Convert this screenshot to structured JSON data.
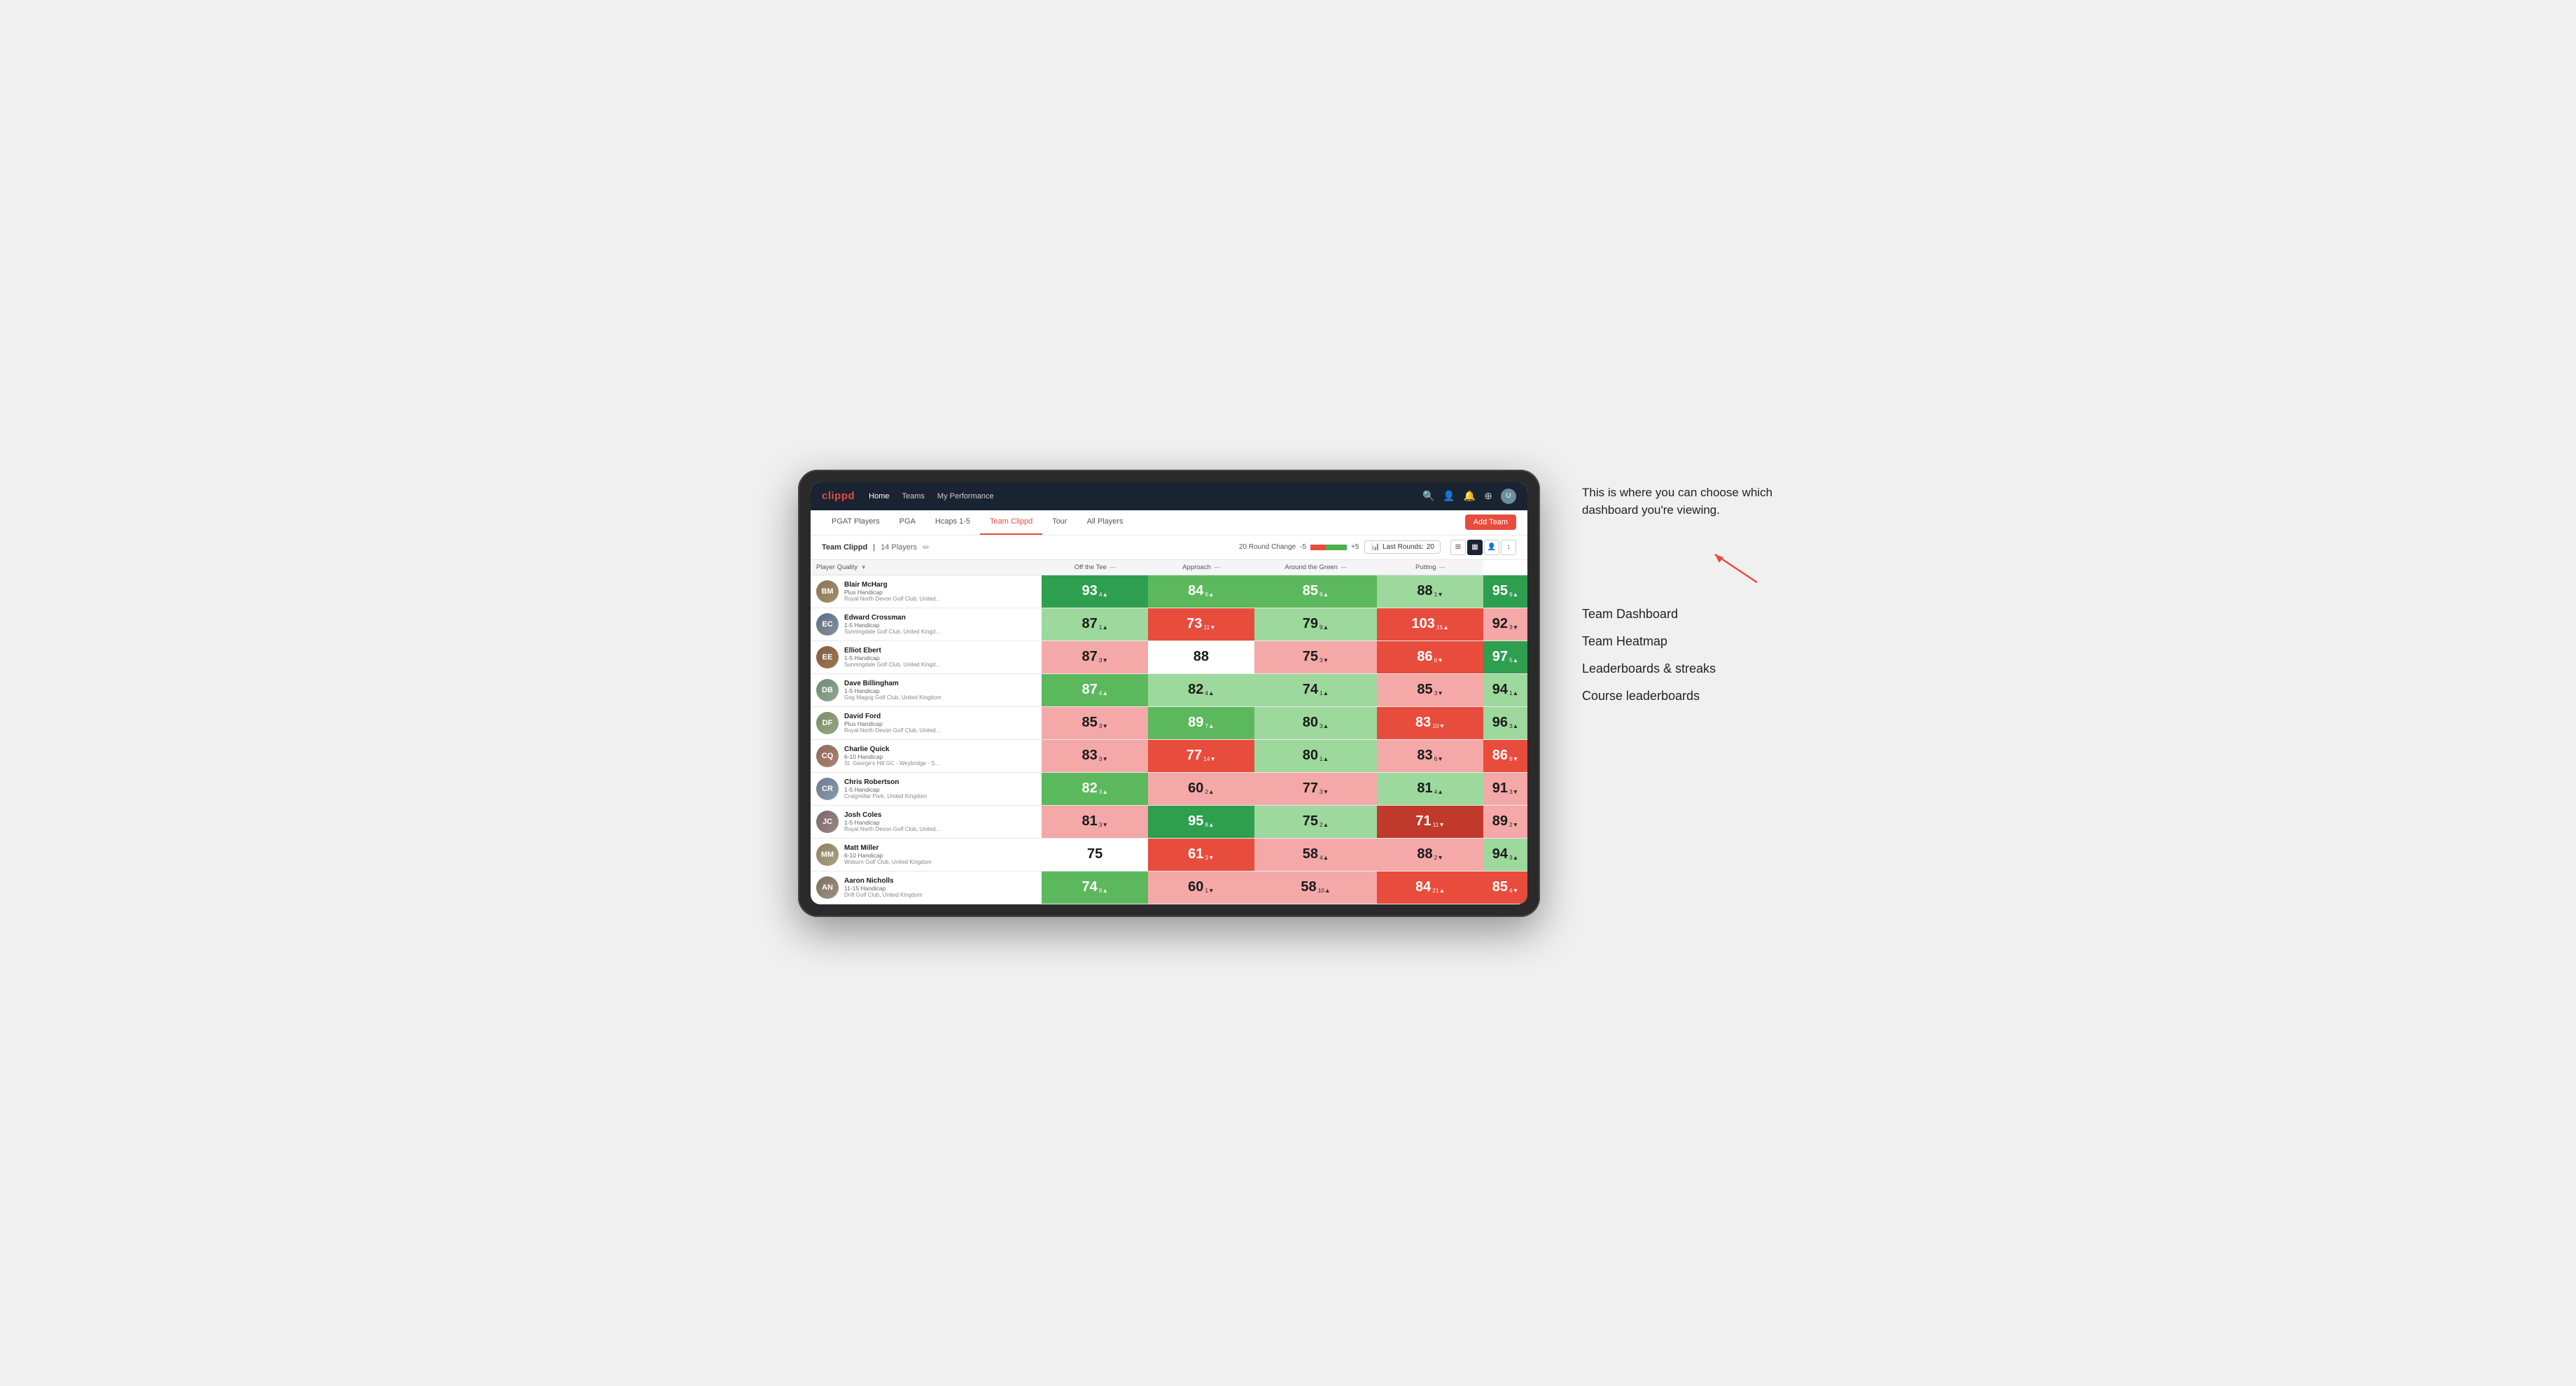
{
  "annotation": {
    "intro_text": "This is where you can choose which dashboard you're viewing.",
    "arrow_symbol": "↗",
    "menu_items": [
      "Team Dashboard",
      "Team Heatmap",
      "Leaderboards & streaks",
      "Course leaderboards"
    ]
  },
  "nav": {
    "logo": "clippd",
    "links": [
      "Home",
      "Teams",
      "My Performance"
    ],
    "icons": [
      "🔍",
      "👤",
      "🔔",
      "⊕",
      "👤"
    ]
  },
  "sub_nav": {
    "items": [
      "PGAT Players",
      "PGA",
      "Hcaps 1-5",
      "Team Clippd",
      "Tour",
      "All Players"
    ],
    "active": "Team Clippd",
    "add_team_label": "Add Team"
  },
  "team_header": {
    "name": "Team Clippd",
    "separator": "|",
    "player_count": "14 Players",
    "round_change_label": "20 Round Change",
    "minus_label": "-5",
    "plus_label": "+5",
    "last_rounds_label": "Last Rounds:",
    "last_rounds_value": "20"
  },
  "table": {
    "col_headers": [
      {
        "label": "Player Quality",
        "sort": "▼",
        "col": "player"
      },
      {
        "label": "Off the Tee",
        "sort": "—",
        "col": "off_tee"
      },
      {
        "label": "Approach",
        "sort": "—",
        "col": "approach"
      },
      {
        "label": "Around the Green",
        "sort": "—",
        "col": "around_green"
      },
      {
        "label": "Putting",
        "sort": "—",
        "col": "putting"
      }
    ],
    "rows": [
      {
        "id": 1,
        "name": "Blair McHarg",
        "handicap": "Plus Handicap",
        "club": "Royal North Devon Golf Club, United Kingdom",
        "avatar_class": "av-1",
        "initials": "BM",
        "player_quality": {
          "value": 93,
          "change": "4",
          "direction": "up",
          "bg": "bg-green-strong"
        },
        "off_tee": {
          "value": 84,
          "change": "6",
          "direction": "up",
          "bg": "bg-green-medium"
        },
        "approach": {
          "value": 85,
          "change": "8",
          "direction": "up",
          "bg": "bg-green-medium"
        },
        "around_green": {
          "value": 88,
          "change": "1",
          "direction": "down",
          "bg": "bg-green-light"
        },
        "putting": {
          "value": 95,
          "change": "9",
          "direction": "up",
          "bg": "bg-green-strong"
        }
      },
      {
        "id": 2,
        "name": "Edward Crossman",
        "handicap": "1-5 Handicap",
        "club": "Sunningdale Golf Club, United Kingdom",
        "avatar_class": "av-2",
        "initials": "EC",
        "player_quality": {
          "value": 87,
          "change": "1",
          "direction": "up",
          "bg": "bg-green-light"
        },
        "off_tee": {
          "value": 73,
          "change": "11",
          "direction": "down",
          "bg": "bg-red-medium"
        },
        "approach": {
          "value": 79,
          "change": "9",
          "direction": "up",
          "bg": "bg-green-light"
        },
        "around_green": {
          "value": 103,
          "change": "15",
          "direction": "up",
          "bg": "bg-red-medium"
        },
        "putting": {
          "value": 92,
          "change": "3",
          "direction": "down",
          "bg": "bg-red-light"
        }
      },
      {
        "id": 3,
        "name": "Elliot Ebert",
        "handicap": "1-5 Handicap",
        "club": "Sunningdale Golf Club, United Kingdom",
        "avatar_class": "av-3",
        "initials": "EE",
        "player_quality": {
          "value": 87,
          "change": "3",
          "direction": "down",
          "bg": "bg-red-light"
        },
        "off_tee": {
          "value": 88,
          "change": "",
          "direction": "",
          "bg": "bg-white"
        },
        "approach": {
          "value": 75,
          "change": "3",
          "direction": "down",
          "bg": "bg-red-light"
        },
        "around_green": {
          "value": 86,
          "change": "6",
          "direction": "down",
          "bg": "bg-red-medium"
        },
        "putting": {
          "value": 97,
          "change": "5",
          "direction": "up",
          "bg": "bg-green-strong"
        }
      },
      {
        "id": 4,
        "name": "Dave Billingham",
        "handicap": "1-5 Handicap",
        "club": "Gog Magog Golf Club, United Kingdom",
        "avatar_class": "av-4",
        "initials": "DB",
        "player_quality": {
          "value": 87,
          "change": "4",
          "direction": "up",
          "bg": "bg-green-medium"
        },
        "off_tee": {
          "value": 82,
          "change": "4",
          "direction": "up",
          "bg": "bg-green-light"
        },
        "approach": {
          "value": 74,
          "change": "1",
          "direction": "up",
          "bg": "bg-green-light"
        },
        "around_green": {
          "value": 85,
          "change": "3",
          "direction": "down",
          "bg": "bg-red-light"
        },
        "putting": {
          "value": 94,
          "change": "1",
          "direction": "up",
          "bg": "bg-green-light"
        }
      },
      {
        "id": 5,
        "name": "David Ford",
        "handicap": "Plus Handicap",
        "club": "Royal North Devon Golf Club, United Kingdom",
        "avatar_class": "av-5",
        "initials": "DF",
        "player_quality": {
          "value": 85,
          "change": "3",
          "direction": "down",
          "bg": "bg-red-light"
        },
        "off_tee": {
          "value": 89,
          "change": "7",
          "direction": "up",
          "bg": "bg-green-medium"
        },
        "approach": {
          "value": 80,
          "change": "3",
          "direction": "up",
          "bg": "bg-green-light"
        },
        "around_green": {
          "value": 83,
          "change": "10",
          "direction": "down",
          "bg": "bg-red-medium"
        },
        "putting": {
          "value": 96,
          "change": "3",
          "direction": "up",
          "bg": "bg-green-light"
        }
      },
      {
        "id": 6,
        "name": "Charlie Quick",
        "handicap": "6-10 Handicap",
        "club": "St. George's Hill GC - Weybridge - Surrey, Uni...",
        "avatar_class": "av-6",
        "initials": "CQ",
        "player_quality": {
          "value": 83,
          "change": "3",
          "direction": "down",
          "bg": "bg-red-light"
        },
        "off_tee": {
          "value": 77,
          "change": "14",
          "direction": "down",
          "bg": "bg-red-medium"
        },
        "approach": {
          "value": 80,
          "change": "1",
          "direction": "up",
          "bg": "bg-green-light"
        },
        "around_green": {
          "value": 83,
          "change": "6",
          "direction": "down",
          "bg": "bg-red-light"
        },
        "putting": {
          "value": 86,
          "change": "8",
          "direction": "down",
          "bg": "bg-red-medium"
        }
      },
      {
        "id": 7,
        "name": "Chris Robertson",
        "handicap": "1-5 Handicap",
        "club": "Craigmillar Park, United Kingdom",
        "avatar_class": "av-7",
        "initials": "CR",
        "player_quality": {
          "value": 82,
          "change": "3",
          "direction": "up",
          "bg": "bg-green-medium"
        },
        "off_tee": {
          "value": 60,
          "change": "2",
          "direction": "up",
          "bg": "bg-red-light"
        },
        "approach": {
          "value": 77,
          "change": "3",
          "direction": "down",
          "bg": "bg-red-light"
        },
        "around_green": {
          "value": 81,
          "change": "4",
          "direction": "up",
          "bg": "bg-green-light"
        },
        "putting": {
          "value": 91,
          "change": "3",
          "direction": "down",
          "bg": "bg-red-light"
        }
      },
      {
        "id": 8,
        "name": "Josh Coles",
        "handicap": "1-5 Handicap",
        "club": "Royal North Devon Golf Club, United Kingdom",
        "avatar_class": "av-8",
        "initials": "JC",
        "player_quality": {
          "value": 81,
          "change": "3",
          "direction": "down",
          "bg": "bg-red-light"
        },
        "off_tee": {
          "value": 95,
          "change": "8",
          "direction": "up",
          "bg": "bg-green-strong"
        },
        "approach": {
          "value": 75,
          "change": "2",
          "direction": "up",
          "bg": "bg-green-light"
        },
        "around_green": {
          "value": 71,
          "change": "11",
          "direction": "down",
          "bg": "bg-red-strong"
        },
        "putting": {
          "value": 89,
          "change": "2",
          "direction": "down",
          "bg": "bg-red-light"
        }
      },
      {
        "id": 9,
        "name": "Matt Miller",
        "handicap": "6-10 Handicap",
        "club": "Woburn Golf Club, United Kingdom",
        "avatar_class": "av-9",
        "initials": "MM",
        "player_quality": {
          "value": 75,
          "change": "",
          "direction": "",
          "bg": "bg-white"
        },
        "off_tee": {
          "value": 61,
          "change": "3",
          "direction": "down",
          "bg": "bg-red-medium"
        },
        "approach": {
          "value": 58,
          "change": "4",
          "direction": "up",
          "bg": "bg-red-light"
        },
        "around_green": {
          "value": 88,
          "change": "2",
          "direction": "down",
          "bg": "bg-red-light"
        },
        "putting": {
          "value": 94,
          "change": "3",
          "direction": "up",
          "bg": "bg-green-light"
        }
      },
      {
        "id": 10,
        "name": "Aaron Nicholls",
        "handicap": "11-15 Handicap",
        "club": "Drift Golf Club, United Kingdom",
        "avatar_class": "av-10",
        "initials": "AN",
        "player_quality": {
          "value": 74,
          "change": "8",
          "direction": "up",
          "bg": "bg-green-medium"
        },
        "off_tee": {
          "value": 60,
          "change": "1",
          "direction": "down",
          "bg": "bg-red-light"
        },
        "approach": {
          "value": 58,
          "change": "10",
          "direction": "up",
          "bg": "bg-red-light"
        },
        "around_green": {
          "value": 84,
          "change": "21",
          "direction": "up",
          "bg": "bg-red-medium"
        },
        "putting": {
          "value": 85,
          "change": "4",
          "direction": "down",
          "bg": "bg-red-medium"
        }
      }
    ]
  }
}
